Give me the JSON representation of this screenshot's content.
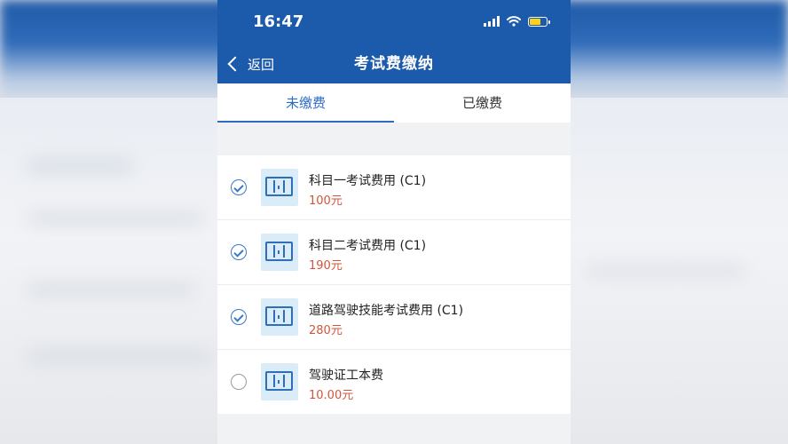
{
  "status_bar": {
    "time": "16:47"
  },
  "nav": {
    "back_label": "返回",
    "title": "考试费缴纳"
  },
  "tabs": [
    {
      "label": "未缴费",
      "active": true
    },
    {
      "label": "已缴费",
      "active": false
    }
  ],
  "items": [
    {
      "title": "科目一考试费用 (C1)",
      "price": "100元",
      "checked": true
    },
    {
      "title": "科目二考试费用 (C1)",
      "price": "190元",
      "checked": true
    },
    {
      "title": "道路驾驶技能考试费用 (C1)",
      "price": "280元",
      "checked": true
    },
    {
      "title": "驾驶证工本费",
      "price": "10.00元",
      "checked": false
    }
  ],
  "colors": {
    "header": "#1c5bab",
    "accent": "#2b6cc4",
    "price": "#d2553b"
  }
}
